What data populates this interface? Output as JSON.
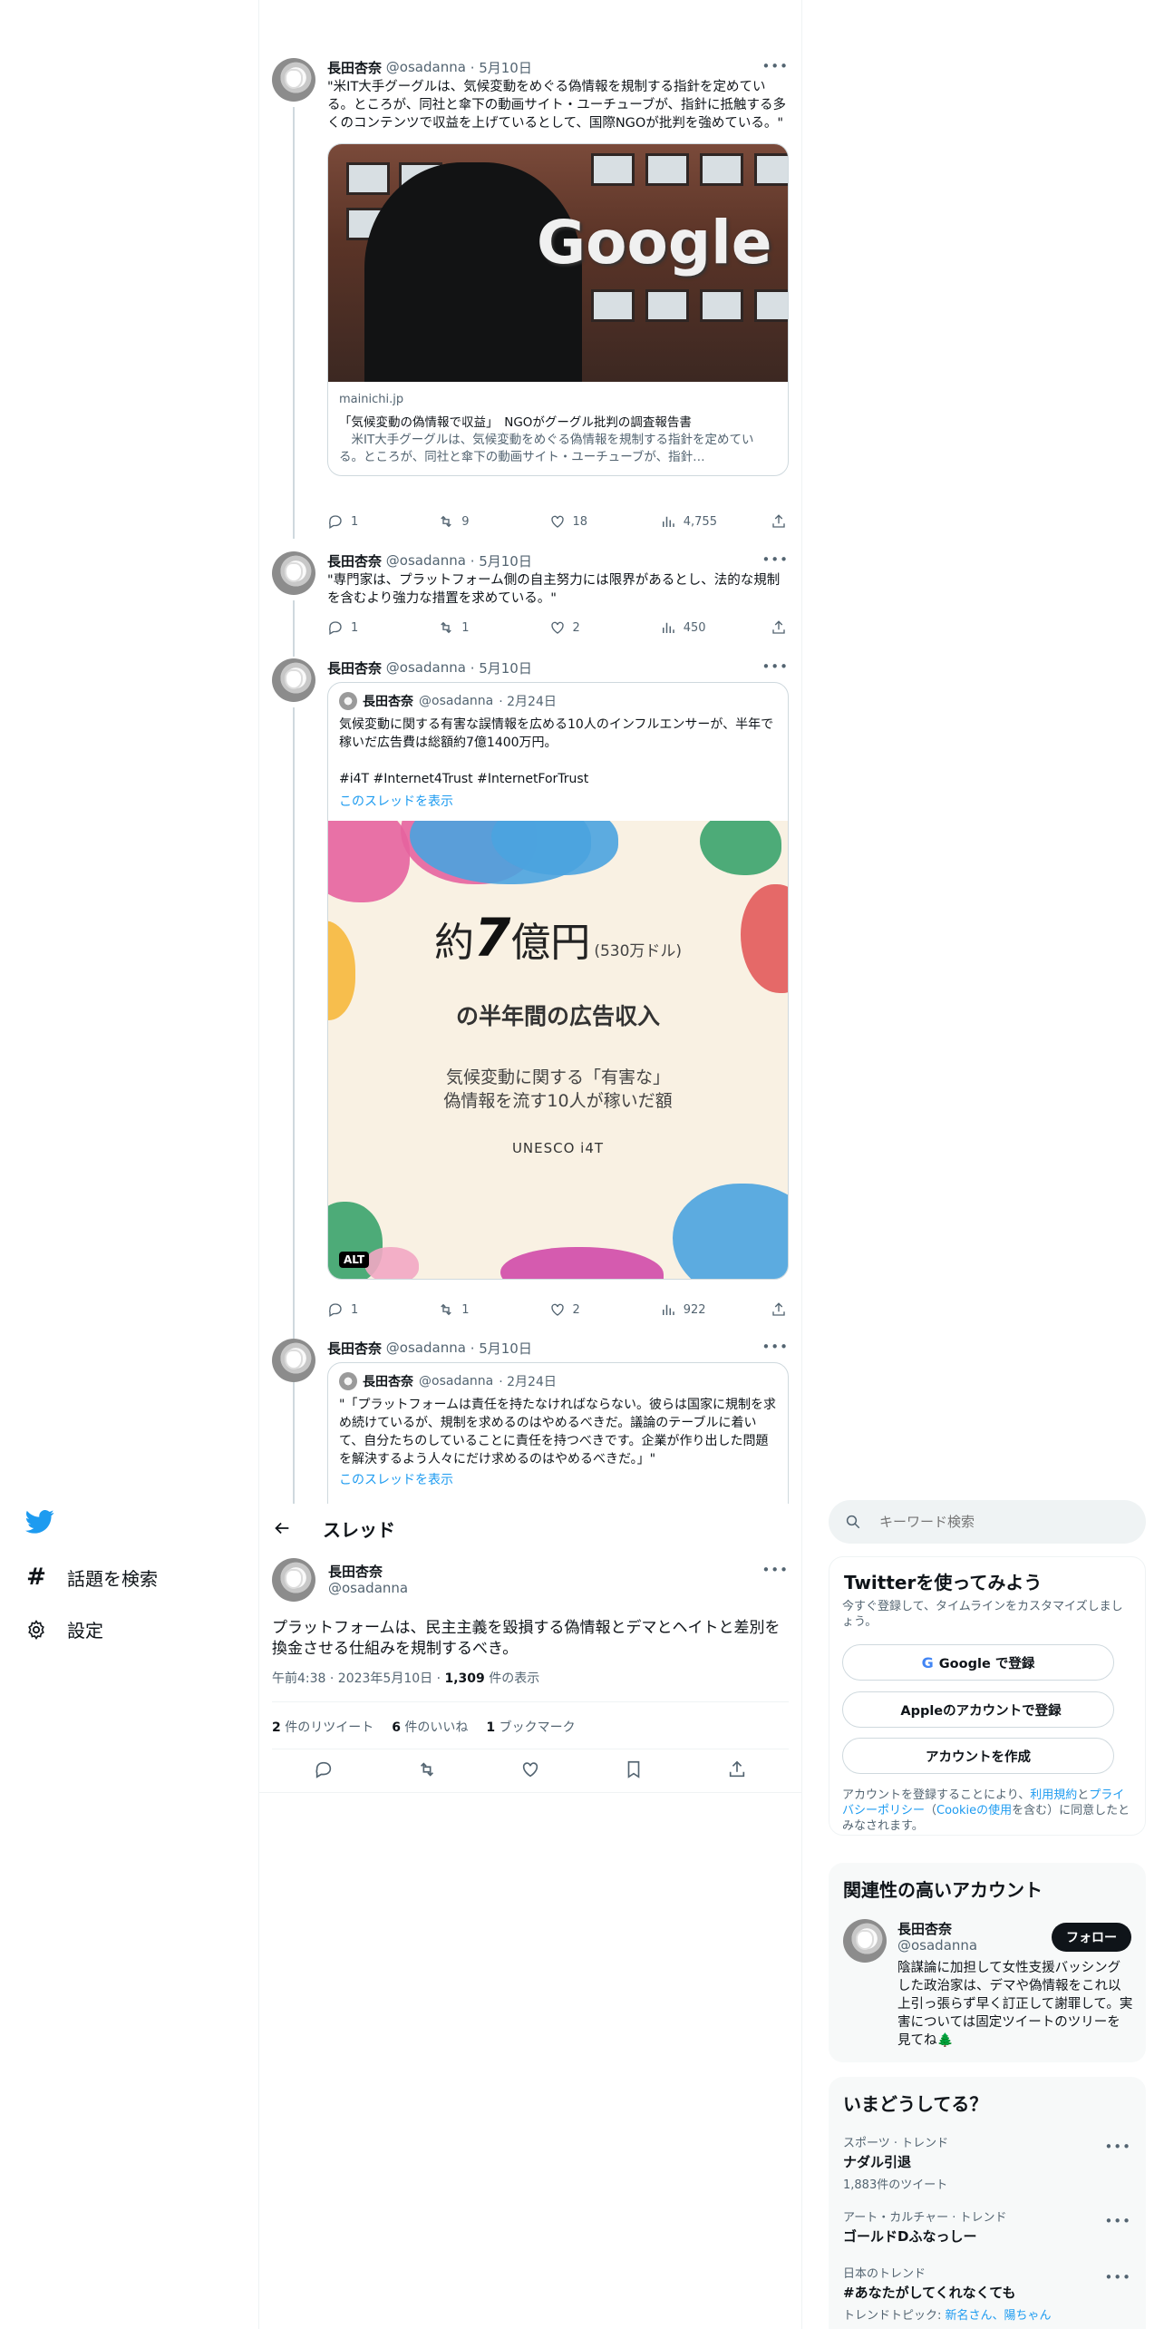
{
  "app": {
    "brand_color": "#1d9bf0"
  },
  "tweets": [
    {
      "name": "長田杏奈",
      "handle": "@osadanna",
      "date": "· 5月10日",
      "text": "\"米IT大手グーグルは、気候変動をめぐる偽情報を規制する指針を定めている。ところが、同社と傘下の動画サイト・ユーチューブが、指針に抵触する多くのコンテンツで収益を上げているとして、国際NGOが批判を強めている。\"",
      "card": {
        "image_text": "Google",
        "domain": "mainichi.jp",
        "title": "「気候変動の偽情報で収益」　NGOがグーグル批判の調査報告書",
        "desc": "　米IT大手グーグルは、気候変動をめぐる偽情報を規制する指針を定めている。ところが、同社と傘下の動画サイト・ユーチューブが、指針…"
      },
      "stats": {
        "reply": "1",
        "retweet": "9",
        "like": "18",
        "views": "4,755"
      }
    },
    {
      "name": "長田杏奈",
      "handle": "@osadanna",
      "date": "· 5月10日",
      "text": "\"専門家は、プラットフォーム側の自主努力には限界があるとし、法的な規制を含むより強力な措置を求めている。\"",
      "stats": {
        "reply": "1",
        "retweet": "1",
        "like": "2",
        "views": "450"
      }
    },
    {
      "name": "長田杏奈",
      "handle": "@osadanna",
      "date": "· 5月10日",
      "quote": {
        "name": "長田杏奈",
        "handle": "@osadanna",
        "date": "· 2月24日",
        "text": "気候変動に関する有害な誤情報を広める10人のインフルエンサーが、半年で稼いだ広告費は総額約7億1400万円。",
        "tags": "#i4T #Internet4Trust #InternetForTrust",
        "show_thread": "このスレッドを表示"
      },
      "promo": {
        "prefix": "約",
        "big": "7",
        "suffix": "億円",
        "paren": "(530万ドル)",
        "headline": "の半年間の広告収入",
        "line1": "気候変動に関する「有害な」",
        "line2": "偽情報を流す10人が稼いだ額",
        "org": "UNESCO i4T",
        "alt": "ALT"
      },
      "stats": {
        "reply": "1",
        "retweet": "1",
        "like": "2",
        "views": "922"
      }
    },
    {
      "name": "長田杏奈",
      "handle": "@osadanna",
      "date": "· 5月10日",
      "quote": {
        "name": "長田杏奈",
        "handle": "@osadanna",
        "date": "· 2月24日",
        "text": "\"「プラットフォームは責任を持たなければならない。彼らは国家に規制を求め続けているが、規制を求めるのはやめるべきだ。議論のテーブルに着いて、自分たちのしていることに責任を持つべきです。企業が作り出した問題を解決するよう人々にだけ求めるのはやめるべきだ。」\"",
        "show_thread": "このスレッドを表示"
      }
    }
  ],
  "header": {
    "title": "スレッド"
  },
  "nav": {
    "explore": "話題を検索",
    "settings": "設定"
  },
  "main_tweet": {
    "name": "長田杏奈",
    "handle": "@osadanna",
    "text": "プラットフォームは、民主主義を毀損する偽情報とデマとヘイトと差別を換金させる仕組みを規制するべき。",
    "time": "午前4:38 · 2023年5月10日 · ",
    "views_num": "1,309",
    "views_label": " 件の表示",
    "retweets_num": "2",
    "retweets_label": " 件のリツイート",
    "likes_num": "6",
    "likes_label": " 件のいいね",
    "bookmarks_num": "1",
    "bookmarks_label": " ブックマーク"
  },
  "search": {
    "placeholder": "キーワード検索"
  },
  "signup": {
    "title": "Twitterを使ってみよう",
    "subtitle": "今すぐ登録して、タイムラインをカスタマイズしましょう。",
    "google": "Google で登録",
    "apple": "Appleのアカウントで登録",
    "create": "アカウントを作成",
    "terms_1": "アカウントを登録することにより、",
    "terms_link1": "利用規約",
    "terms_2": "と",
    "terms_link2": "プライバシーポリシー",
    "terms_3": "（",
    "terms_link3": "Cookieの使用",
    "terms_4": "を含む）に同意したとみなされます。"
  },
  "related": {
    "title": "関連性の高いアカウント",
    "name": "長田杏奈",
    "handle": "@osadanna",
    "follow": "フォロー",
    "bio": "陰謀論に加担して女性支援バッシングした政治家は、デマや偽情報をこれ以上引っ張らず早く訂正して謝罪して。実害については固定ツイートのツリーを見てね🌲"
  },
  "trends": {
    "title": "いまどうしてる？",
    "items": [
      {
        "cat": "スポーツ · トレンド",
        "title": "ナダル引退",
        "sub": "1,883件のツイート"
      },
      {
        "cat": "アート・カルチャー · トレンド",
        "title": "ゴールドDふなっしー",
        "sub": ""
      },
      {
        "cat": "日本のトレンド",
        "title": "#あなたがしてくれなくても",
        "sub_prefix": "トレンドトピック: ",
        "sub_link": "新名さん、陽ちゃん"
      }
    ]
  }
}
